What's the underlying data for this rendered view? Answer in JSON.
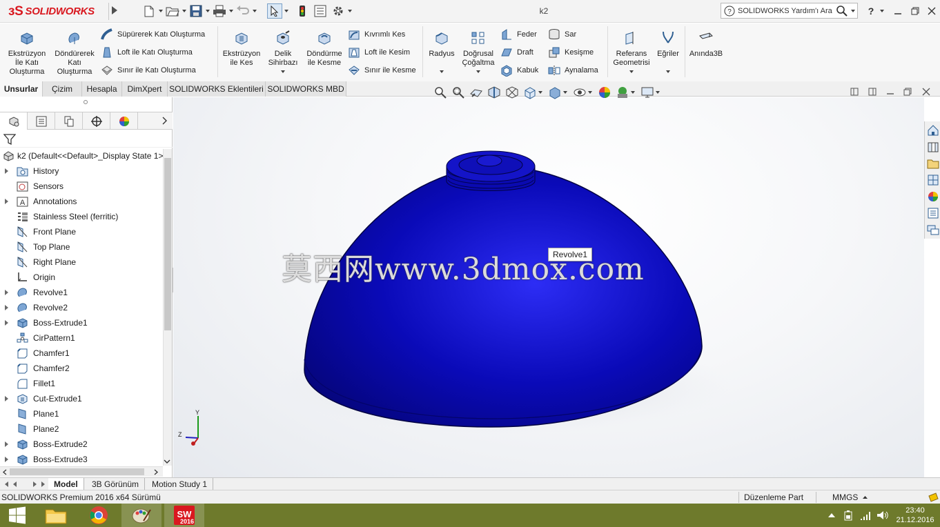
{
  "app": {
    "logo_text": "SOLIDWORKS",
    "document_title": "k2",
    "help_search_placeholder": "SOLIDWORKS Yardım'ı Ara",
    "help_label": "?"
  },
  "ribbon": {
    "big_buttons": [
      {
        "id": "extrude",
        "label": "Ekstrüzyon İle Katı Oluşturma",
        "icon": "extrude-boss-icon"
      },
      {
        "id": "revolve",
        "label": "Döndürerek Katı Oluşturma",
        "icon": "revolve-boss-icon"
      },
      {
        "id": "extrude-cut",
        "label": "Ekstrüzyon ile Kes",
        "icon": "extrude-cut-icon"
      },
      {
        "id": "hole-wizard",
        "label": "Delik Sihirbazı",
        "icon": "hole-wizard-icon"
      },
      {
        "id": "revolve-cut",
        "label": "Döndürme ile Kesme",
        "icon": "revolve-cut-icon"
      },
      {
        "id": "fillet",
        "label": "Radyus",
        "icon": "fillet-icon"
      },
      {
        "id": "linear-pattern",
        "label": "Doğrusal Çoğaltma",
        "icon": "linear-pattern-icon"
      },
      {
        "id": "ref-geometry",
        "label": "Referans Geometrisi",
        "icon": "reference-geometry-icon"
      },
      {
        "id": "curves",
        "label": "Eğriler",
        "icon": "curves-icon"
      },
      {
        "id": "instant3d",
        "label": "Anında3B",
        "icon": "instant3d-icon"
      }
    ],
    "small_buttons": [
      {
        "id": "sweep",
        "label": "Süpürerek Katı Oluşturma",
        "icon": "sweep-icon"
      },
      {
        "id": "loft",
        "label": "Loft ile Katı Oluşturma",
        "icon": "loft-icon"
      },
      {
        "id": "boundary",
        "label": "Sınır ile Katı Oluşturma",
        "icon": "boundary-boss-icon"
      },
      {
        "id": "swept-cut",
        "label": "Kıvrımlı Kes",
        "icon": "swept-cut-icon"
      },
      {
        "id": "loft-cut",
        "label": "Loft ile Kesim",
        "icon": "loft-cut-icon"
      },
      {
        "id": "boundary-cut",
        "label": "Sınır ile Kesme",
        "icon": "boundary-cut-icon"
      },
      {
        "id": "rib",
        "label": "Feder",
        "icon": "rib-icon"
      },
      {
        "id": "draft",
        "label": "Draft",
        "icon": "draft-icon"
      },
      {
        "id": "shell",
        "label": "Kabuk",
        "icon": "shell-icon"
      },
      {
        "id": "wrap",
        "label": "Sar",
        "icon": "wrap-icon"
      },
      {
        "id": "intersect",
        "label": "Kesişme",
        "icon": "intersect-icon"
      },
      {
        "id": "mirror",
        "label": "Aynalama",
        "icon": "mirror-icon"
      }
    ]
  },
  "command_tabs": [
    "Unsurlar",
    "Çizim",
    "Hesapla",
    "DimXpert",
    "SOLIDWORKS Eklentileri",
    "SOLIDWORKS MBD"
  ],
  "feature_tree": {
    "root_label": "k2  (Default<<Default>_Display State 1>",
    "items": [
      {
        "label": "History",
        "icon": "history-folder-icon",
        "expandable": true
      },
      {
        "label": "Sensors",
        "icon": "sensors-icon",
        "expandable": false
      },
      {
        "label": "Annotations",
        "icon": "annotations-icon",
        "expandable": true
      },
      {
        "label": "Stainless Steel (ferritic)",
        "icon": "material-icon",
        "expandable": false
      },
      {
        "label": "Front Plane",
        "icon": "plane-icon",
        "expandable": false
      },
      {
        "label": "Top Plane",
        "icon": "plane-icon",
        "expandable": false
      },
      {
        "label": "Right Plane",
        "icon": "plane-icon",
        "expandable": false
      },
      {
        "label": "Origin",
        "icon": "origin-icon",
        "expandable": false
      },
      {
        "label": "Revolve1",
        "icon": "revolve-feature-icon",
        "expandable": true
      },
      {
        "label": "Revolve2",
        "icon": "revolve-feature-icon",
        "expandable": true
      },
      {
        "label": "Boss-Extrude1",
        "icon": "extrude-feature-icon",
        "expandable": true
      },
      {
        "label": "CirPattern1",
        "icon": "circular-pattern-icon",
        "expandable": false
      },
      {
        "label": "Chamfer1",
        "icon": "chamfer-icon",
        "expandable": false
      },
      {
        "label": "Chamfer2",
        "icon": "chamfer-icon",
        "expandable": false
      },
      {
        "label": "Fillet1",
        "icon": "fillet-feature-icon",
        "expandable": false
      },
      {
        "label": "Cut-Extrude1",
        "icon": "cut-extrude-icon",
        "expandable": true
      },
      {
        "label": "Plane1",
        "icon": "ref-plane-icon",
        "expandable": false
      },
      {
        "label": "Plane2",
        "icon": "ref-plane-icon",
        "expandable": false
      },
      {
        "label": "Boss-Extrude2",
        "icon": "extrude-feature-icon",
        "expandable": true
      },
      {
        "label": "Boss-Extrude3",
        "icon": "extrude-feature-icon",
        "expandable": true
      }
    ]
  },
  "viewport": {
    "tooltip": "Revolve1",
    "watermark": "莫西网www.3dmox.com",
    "model_color": "#0a0ab4",
    "triad": {
      "x": "",
      "y": "Y",
      "z": "Z"
    }
  },
  "bottom_tabs": [
    "Model",
    "3B Görünüm",
    "Motion Study 1"
  ],
  "status_bar": {
    "left": "SOLIDWORKS Premium 2016 x64 Sürümü",
    "mode": "Düzenleme Part",
    "units": "MMGS"
  },
  "taskbar": {
    "time": "23:40",
    "date": "21.12.2016",
    "sw_badge": "2016"
  },
  "colors": {
    "brand_red": "#d9181f",
    "taskbar": "#6e7a2c"
  }
}
